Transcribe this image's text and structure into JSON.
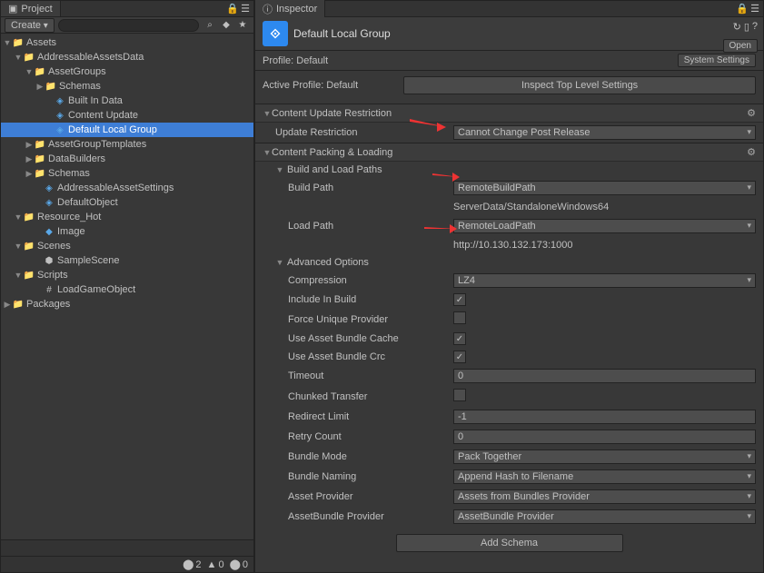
{
  "projectTab": {
    "title": "Project",
    "createBtn": "Create",
    "status": {
      "warn": "2",
      "tri": "0",
      "info": "0"
    }
  },
  "inspectorTab": {
    "title": "Inspector"
  },
  "tree": {
    "root1": "Assets",
    "addressable": "AddressableAssetsData",
    "assetGroups": "AssetGroups",
    "schemas": "Schemas",
    "builtIn": "Built In Data",
    "contentUpdate": "Content Update",
    "defaultLocalGroup": "Default Local Group",
    "assetGroupTemplates": "AssetGroupTemplates",
    "dataBuilders": "DataBuilders",
    "schemas2": "Schemas",
    "addressableSettings": "AddressableAssetSettings",
    "defaultObject": "DefaultObject",
    "resourceHot": "Resource_Hot",
    "image": "Image",
    "scenes": "Scenes",
    "sampleScene": "SampleScene",
    "scripts": "Scripts",
    "loadGameObject": "LoadGameObject",
    "packages": "Packages"
  },
  "inspector": {
    "title": "Default Local Group",
    "openBtn": "Open",
    "profileLabel": "Profile: Default",
    "systemSettings": "System Settings",
    "activeProfile": "Active Profile: Default",
    "inspectTop": "Inspect Top Level Settings",
    "contentUpdateHeader": "Content Update Restriction",
    "updateRestrictionLabel": "Update Restriction",
    "updateRestrictionValue": "Cannot Change Post Release",
    "contentPackingHeader": "Content Packing & Loading",
    "buildLoadPaths": "Build and Load Paths",
    "buildPathLabel": "Build Path",
    "buildPathValue": "RemoteBuildPath",
    "buildPathStatic": "ServerData/StandaloneWindows64",
    "loadPathLabel": "Load Path",
    "loadPathValue": "RemoteLoadPath",
    "loadPathStatic": "http://10.130.132.173:1000",
    "advancedOptions": "Advanced Options",
    "compressionLabel": "Compression",
    "compressionValue": "LZ4",
    "includeInBuild": "Include In Build",
    "forceUnique": "Force Unique Provider",
    "useCache": "Use Asset Bundle Cache",
    "useCrc": "Use Asset Bundle Crc",
    "timeoutLabel": "Timeout",
    "timeoutValue": "0",
    "chunked": "Chunked Transfer",
    "redirectLabel": "Redirect Limit",
    "redirectValue": "-1",
    "retryLabel": "Retry Count",
    "retryValue": "0",
    "bundleModeLabel": "Bundle Mode",
    "bundleModeValue": "Pack Together",
    "bundleNamingLabel": "Bundle Naming",
    "bundleNamingValue": "Append Hash to Filename",
    "assetProviderLabel": "Asset Provider",
    "assetProviderValue": "Assets from Bundles Provider",
    "bundleProviderLabel": "AssetBundle Provider",
    "bundleProviderValue": "AssetBundle Provider",
    "addSchema": "Add Schema"
  }
}
